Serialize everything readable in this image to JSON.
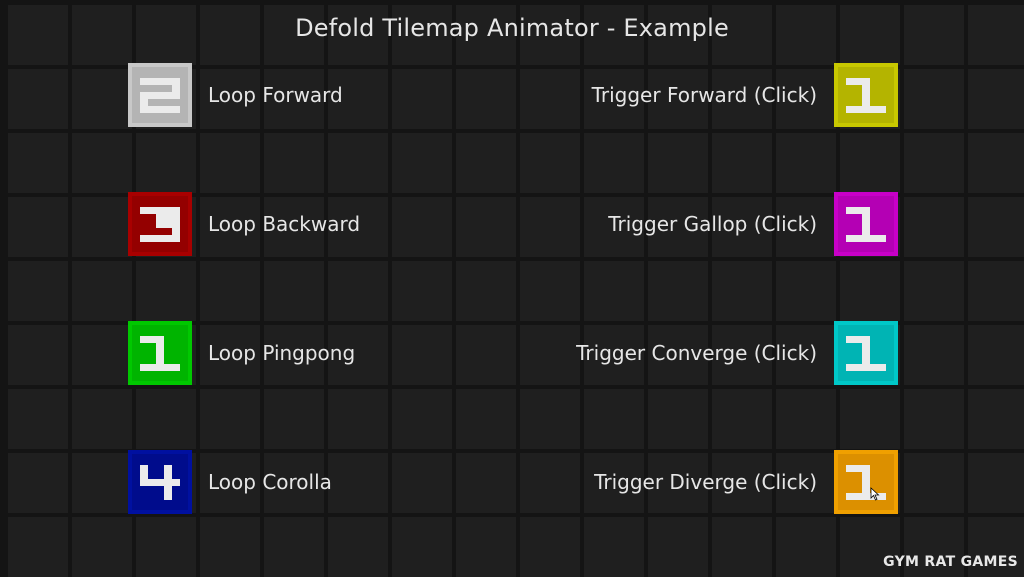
{
  "title": "Defold Tilemap Animator - Example",
  "left_items": [
    {
      "label": "Loop Forward",
      "digit": "2",
      "color": "#c8c8c8",
      "shade": "#b4b4b4",
      "icon": "digit-2-tile-icon"
    },
    {
      "label": "Loop Backward",
      "digit": "3",
      "color": "#a80000",
      "shade": "#940000",
      "icon": "digit-3-tile-icon"
    },
    {
      "label": "Loop Pingpong",
      "digit": "1",
      "color": "#00c800",
      "shade": "#00b400",
      "icon": "digit-1-tile-icon"
    },
    {
      "label": "Loop Corolla",
      "digit": "4",
      "color": "#0010a0",
      "shade": "#000c8c",
      "icon": "digit-4-tile-icon"
    }
  ],
  "right_items": [
    {
      "label": "Trigger Forward (Click)",
      "digit": "1",
      "color": "#c8c800",
      "shade": "#b4b400",
      "icon": "digit-1-tile-icon"
    },
    {
      "label": "Trigger Gallop (Click)",
      "digit": "1",
      "color": "#c800c8",
      "shade": "#b400b4",
      "icon": "digit-1-tile-icon"
    },
    {
      "label": "Trigger Converge (Click)",
      "digit": "1",
      "color": "#00c8c8",
      "shade": "#00b4b4",
      "icon": "digit-1-tile-icon"
    },
    {
      "label": "Trigger Diverge (Click)",
      "digit": "1",
      "color": "#f0a000",
      "shade": "#dc9000",
      "icon": "digit-1-tile-icon"
    }
  ],
  "watermark": "GYM RAT GAMES",
  "colors": {
    "background": "#141414",
    "grid_cell": "#1f1f1f",
    "text": "#e6e6e6",
    "glyph": "#ebebeb"
  }
}
